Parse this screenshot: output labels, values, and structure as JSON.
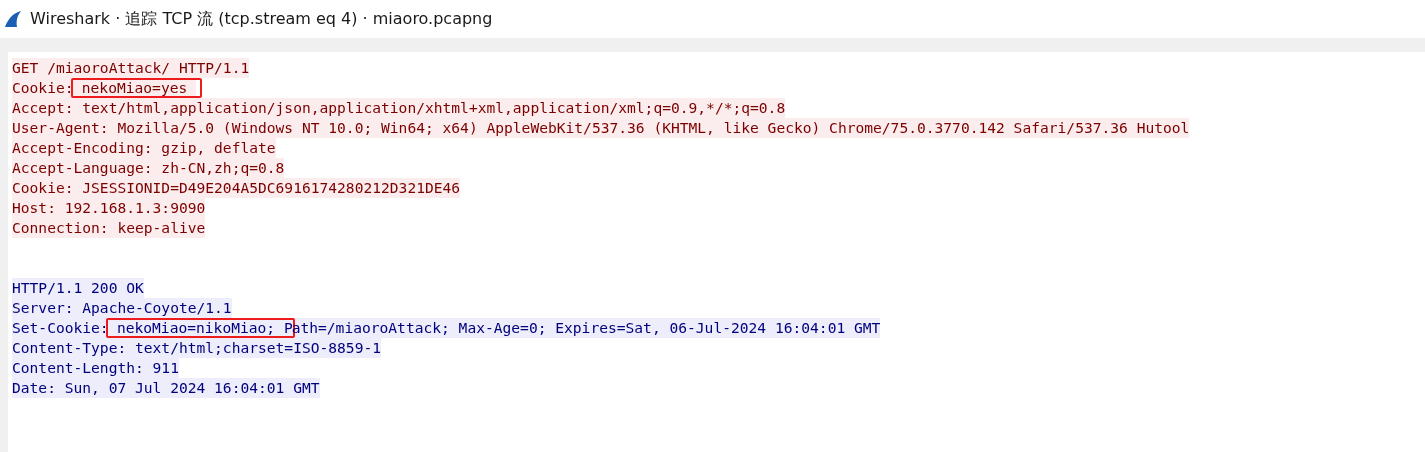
{
  "window": {
    "title": "Wireshark · 追踪 TCP 流 (tcp.stream eq 4) · miaoro.pcapng"
  },
  "stream": [
    {
      "kind": "client",
      "lines": [
        {
          "text": "GET /miaoroAttack/ HTTP/1.1"
        },
        {
          "text": "Cookie:",
          "marked": " nekoMiao=yes"
        },
        {
          "text": "Accept: text/html,application/json,application/xhtml+xml,application/xml;q=0.9,*/*;q=0.8"
        },
        {
          "text": "User-Agent: Mozilla/5.0 (Windows NT 10.0; Win64; x64) AppleWebKit/537.36 (KHTML, like Gecko) Chrome/75.0.3770.142 Safari/537.36 Hutool"
        },
        {
          "text": "Accept-Encoding: gzip, deflate"
        },
        {
          "text": "Accept-Language: zh-CN,zh;q=0.8"
        },
        {
          "text": "Cookie: JSESSIONID=D49E204A5DC6916174280212D321DE46"
        },
        {
          "text": "Host: 192.168.1.3:9090"
        },
        {
          "text": "Connection: keep-alive"
        }
      ]
    },
    {
      "kind": "server",
      "lines": [
        {
          "text": "HTTP/1.1 200 OK"
        },
        {
          "text": "Server: Apache-Coyote/1.1"
        },
        {
          "text": "Set-Cookie:",
          "marked": " nekoMiao=nikoMiao; P",
          "after": "ath=/miaoroAttack; Max-Age=0; Expires=Sat, 06-Jul-2024 16:04:01 GMT"
        },
        {
          "text": "Content-Type: text/html;charset=ISO-8859-1"
        },
        {
          "text": "Content-Length: 911"
        },
        {
          "text": "Date: Sun, 07 Jul 2024 16:04:01 GMT"
        }
      ]
    }
  ]
}
